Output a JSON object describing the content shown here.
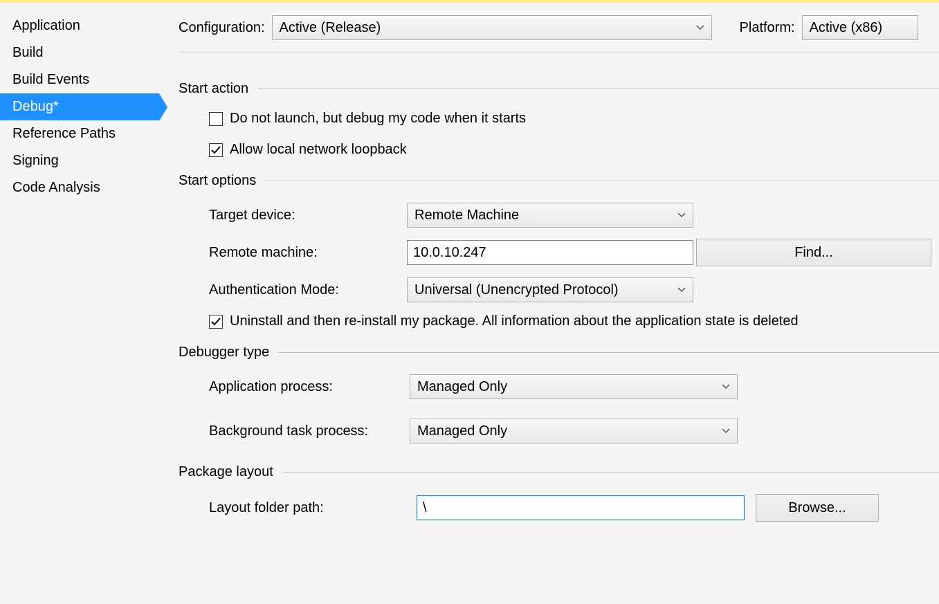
{
  "sidebar": {
    "items": [
      {
        "label": "Application",
        "active": false
      },
      {
        "label": "Build",
        "active": false
      },
      {
        "label": "Build Events",
        "active": false
      },
      {
        "label": "Debug*",
        "active": true
      },
      {
        "label": "Reference Paths",
        "active": false
      },
      {
        "label": "Signing",
        "active": false
      },
      {
        "label": "Code Analysis",
        "active": false
      }
    ]
  },
  "config": {
    "configuration_label": "Configuration:",
    "configuration_value": "Active (Release)",
    "platform_label": "Platform:",
    "platform_value": "Active (x86)"
  },
  "start_action": {
    "title": "Start action",
    "do_not_launch": {
      "label": "Do not launch, but debug my code when it starts",
      "checked": false
    },
    "allow_loopback": {
      "label": "Allow local network loopback",
      "checked": true
    }
  },
  "start_options": {
    "title": "Start options",
    "target_device": {
      "label": "Target device:",
      "value": "Remote Machine"
    },
    "remote_machine": {
      "label": "Remote machine:",
      "value": "10.0.10.247",
      "find_button": "Find..."
    },
    "auth_mode": {
      "label": "Authentication Mode:",
      "value": "Universal (Unencrypted Protocol)"
    },
    "uninstall": {
      "label": "Uninstall and then re-install my package. All information about the application state is deleted",
      "checked": true
    }
  },
  "debugger_type": {
    "title": "Debugger type",
    "app_process": {
      "label": "Application process:",
      "value": "Managed Only"
    },
    "bg_process": {
      "label": "Background task process:",
      "value": "Managed Only"
    }
  },
  "package_layout": {
    "title": "Package layout",
    "layout_path": {
      "label": "Layout folder path:",
      "value": "\\",
      "browse_button": "Browse..."
    }
  }
}
